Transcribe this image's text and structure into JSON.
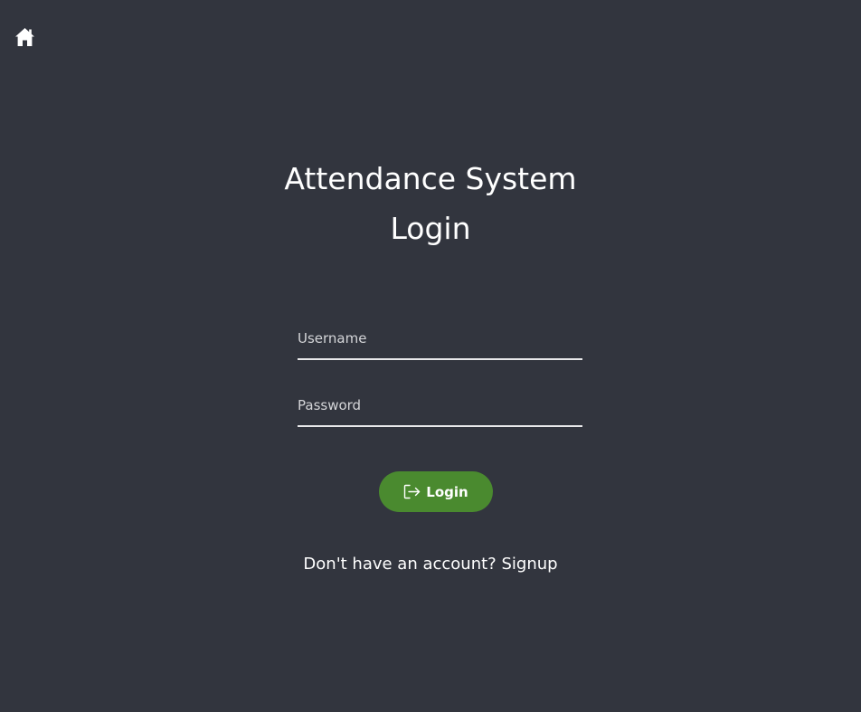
{
  "nav": {
    "home_icon": "home-icon"
  },
  "header": {
    "app_title": "Attendance System",
    "page_title": "Login"
  },
  "form": {
    "username_placeholder": "Username",
    "username_value": "",
    "password_placeholder": "Password",
    "password_value": "",
    "login_label": "Login",
    "login_icon": "sign-in-icon"
  },
  "footer": {
    "prompt": "Don't have an account?",
    "signup_label": "Signup"
  },
  "colors": {
    "background": "#32353e",
    "button": "#4a8a2f",
    "text": "#ffffff"
  }
}
